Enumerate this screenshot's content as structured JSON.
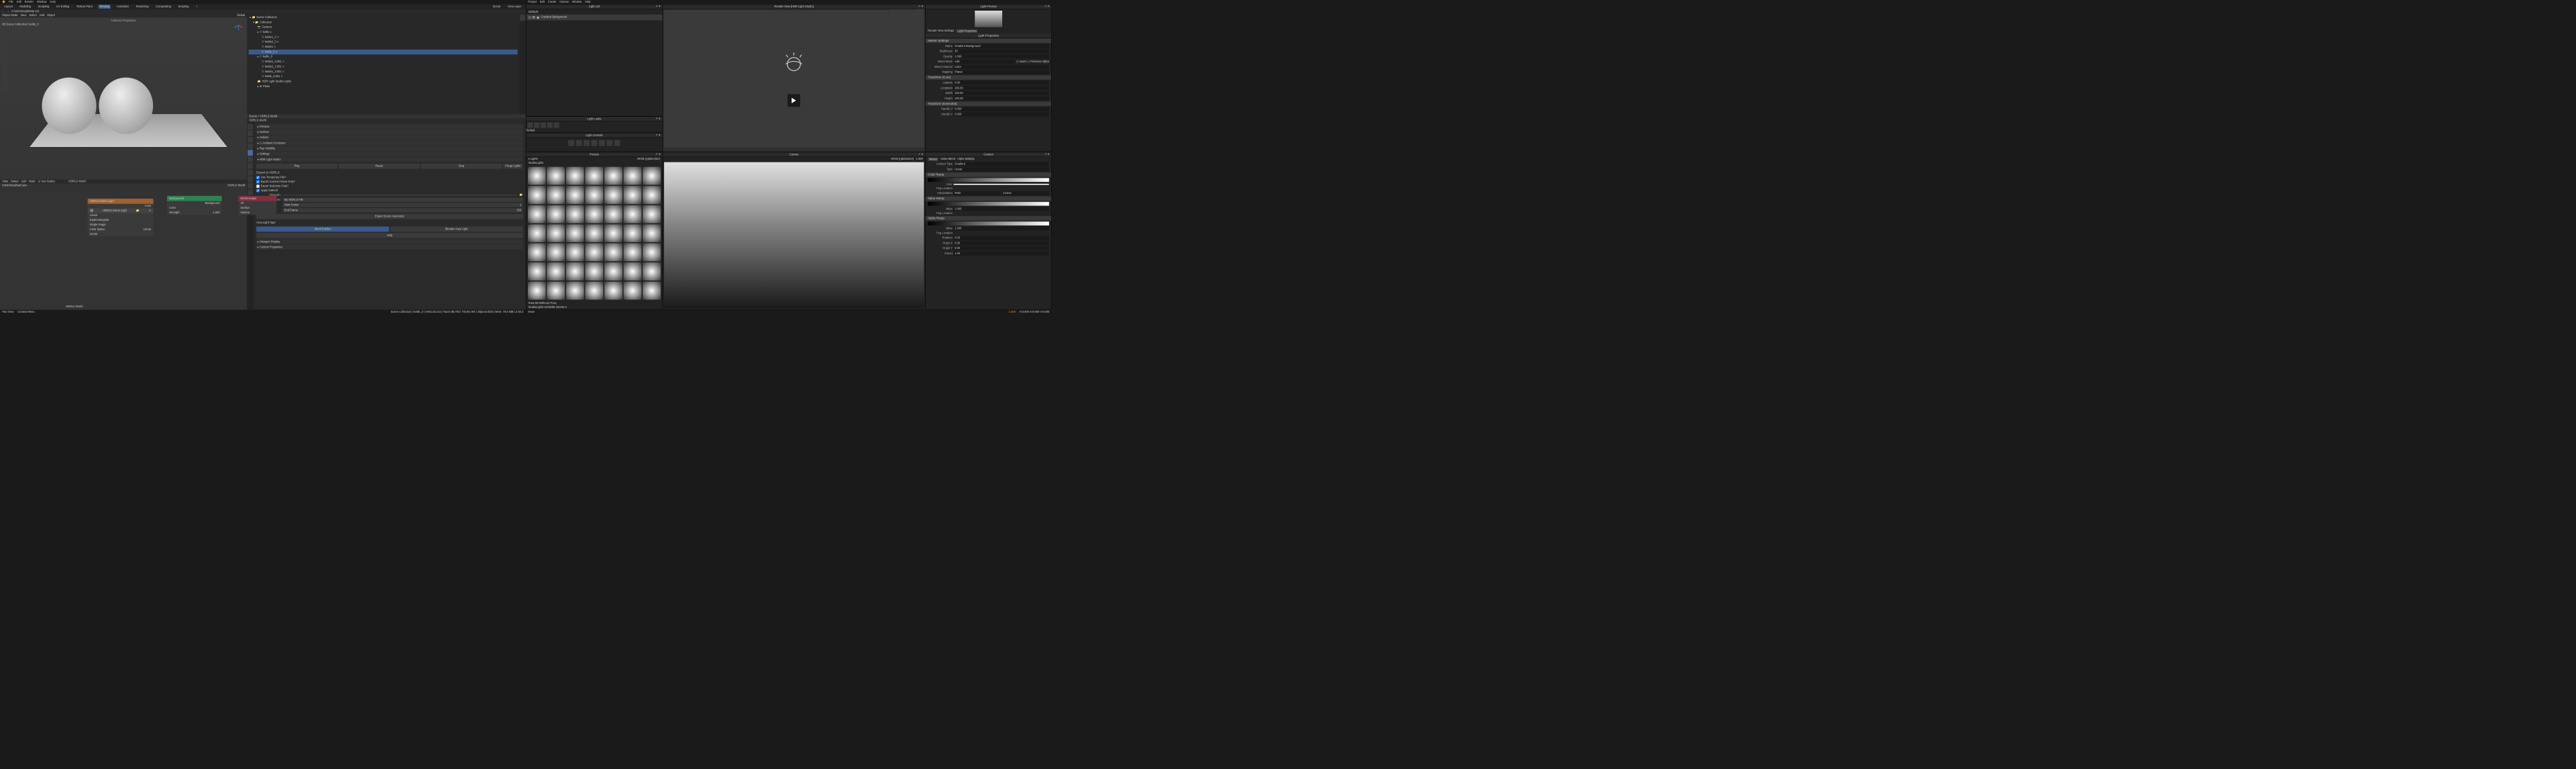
{
  "blender": {
    "menus": [
      "File",
      "Edit",
      "Render",
      "Window",
      "Help"
    ],
    "tabs": [
      "Layout",
      "Modeling",
      "Sculpting",
      "UV Editing",
      "Texture Paint",
      "Shading",
      "Animation",
      "Rendering",
      "Compositing",
      "Scripting",
      "+"
    ],
    "active_tab": "Shading",
    "scene_label": "Scene",
    "viewlayer_label": "View Layer",
    "path": "C:\\Users\\Lightmap Ltd.",
    "toolbar": {
      "mode": "Object Mode",
      "view": "View",
      "select": "Select",
      "add": "Add",
      "object": "Object",
      "global": "Global"
    },
    "viewport": {
      "camera": "Camera Perspective",
      "collection": "(0) Scene Collection | kettle_0"
    },
    "node_header": {
      "view": "View",
      "select": "Select",
      "add": "Add",
      "node": "Node",
      "use_nodes": "Use Nodes",
      "world": "HDRLS World"
    },
    "nodes": {
      "hdrls": {
        "title": "HDRLS Dome Light",
        "color": "Color",
        "name": "HDRLS Dome Light",
        "linear1": "Linear",
        "proj": "Equirectangular",
        "single": "Single Image",
        "cspace": "Color Space",
        "linear2": "Linear",
        "vector": "Vector"
      },
      "bg": {
        "title": "Background",
        "out": "Background",
        "color": "Color",
        "strength": "Strength",
        "strength_v": "1.000"
      },
      "world": {
        "title": "World Output",
        "all": "All",
        "surface": "Surface",
        "volume": "Volume"
      },
      "label": "HDRLS World",
      "file": "HdrlsTempRawCanv"
    },
    "outliner": {
      "title": "Scene Collection",
      "items": [
        "Collection",
        "Camera",
        "kettle 1",
        "kettle1_3",
        "kettle2_3",
        "kettle1",
        "kettle_0",
        "kettle_0",
        "kettle1_3.001",
        "kettle2_2.001",
        "kettle1_3.001",
        "kettle_3.001",
        "HDR Light Studio Lights",
        "Plane"
      ],
      "breadcrumb": "Scene > HDRLS World",
      "world": "HDRLS World"
    },
    "props": {
      "sections": [
        "Preview",
        "Surface",
        "Volume",
        "Ambient Occlusion",
        "Ray Visibility",
        "Settings",
        "HDR Light Studio"
      ],
      "active": "HDR Light Studio",
      "play": "Play",
      "pause": "Pause",
      "stop": "Stop",
      "purge": "Purge Lights",
      "export_h": "Export to HDRLS",
      "checks": [
        "Use Temporary File?",
        "Export Current Frame Only?",
        "Export Selection Only?",
        "Apply Subsurf"
      ],
      "filepath": "Filepath:",
      "filename": "Filename:",
      "filename_v": "My HDRLS File",
      "start": "Start Frame",
      "start_v": "1",
      "end": "End Frame",
      "end_v": "250",
      "export_geo": "Export Scene Geometry",
      "alt": "Area Light Type",
      "alt1": "Mesh Emitter",
      "alt2": "Blender Area Light",
      "help": "Help",
      "vd": "Viewport Display",
      "cp": "Custom Properties"
    },
    "status": {
      "panview": "Pan View",
      "context": "Context Menu",
      "info": "Scene Collection | kettle_0 | Verts:43,416 | Faces:86,793 | Tris:86,794 | Objects:0/20 | Mem: 76.0 MiB | 2.83.4"
    }
  },
  "hls": {
    "menus": [
      "Project",
      "Edit",
      "Create",
      "Canvas",
      "Window",
      "Help"
    ],
    "light_list": {
      "title": "Light List",
      "default": "Default",
      "item": "Gradient Background"
    },
    "looks": {
      "title": "Light Looks",
      "default": "Default"
    },
    "controls": {
      "title": "Light Controls"
    },
    "render": {
      "title": "Render View [HDR Light Studio]",
      "space": "sRGB (rgbMonitor)",
      "rgba": "RGB[A]"
    },
    "rv_settings": "Render View Settings",
    "lp": "Light Properties",
    "preview_title": "Light Preview",
    "props": {
      "title": "Light Properties",
      "master": "Master Settings",
      "name_l": "Name",
      "name": "Gradient Background",
      "bright_l": "Brightness",
      "bright": "30",
      "opacity_l": "Opacity",
      "opacity": "1.000",
      "blend_l": "Blend Mode",
      "blend": "Add",
      "invert": "Invert",
      "palpha": "Preserve Alpha",
      "bchan_l": "Blend Channel",
      "bchan": "Color",
      "map_l": "Mapping",
      "map": "Planar",
      "t3d": "Transform (Core)",
      "lat_l": "Latitude",
      "lat": "0.00",
      "lon_l": "Longitude",
      "lon": "180.00",
      "w_l": "Width",
      "w": "100.00",
      "h_l": "Height",
      "h": "100.00",
      "text": "Transform (Extended)",
      "hu_l": "Handle U",
      "hu": "0.500",
      "hv_l": "Handle V",
      "hv": "0.500"
    },
    "presets": {
      "title": "Presets",
      "lights": "Lights",
      "space": "sRGB (rgbMonitor)",
      "studio": "StudioLights",
      "caption": "Para 88 Reflector Pos1",
      "file": "StudioLights.Umbrella Nevin5.4"
    },
    "canvas": {
      "title": "Canvas",
      "space": "sRGB (rgbMonitor)",
      "val": "1.000"
    },
    "content": {
      "title": "Content",
      "master": "Master",
      "vb": "Value Blend",
      "am": "Alpha Multiply",
      "ct_l": "Content Type",
      "ct": "Gradient",
      "type_l": "Type",
      "type": "Linear",
      "cr": "Color Ramp",
      "color_l": "Color",
      "peg": "Peg Location",
      "interp_l": "Interpolation",
      "interp": "RGB",
      "cosine": "Cosine",
      "vr": "Value Ramp",
      "val_l": "Value",
      "val": "1.000",
      "ar": "Alpha Ramp",
      "alpha_l": "Value",
      "alpha": "1.000",
      "rot_l": "Rotation",
      "rot": "0.00",
      "ox_l": "Origin X",
      "ox": "0.00",
      "oy_l": "Origin Y",
      "oy": "0.00",
      "ext_l": "Extent",
      "ext": "1.00"
    },
    "status": {
      "move": "Move",
      "brush": "1.000",
      "hsv": "H:0.000 S:0.000 V:0.000"
    }
  }
}
